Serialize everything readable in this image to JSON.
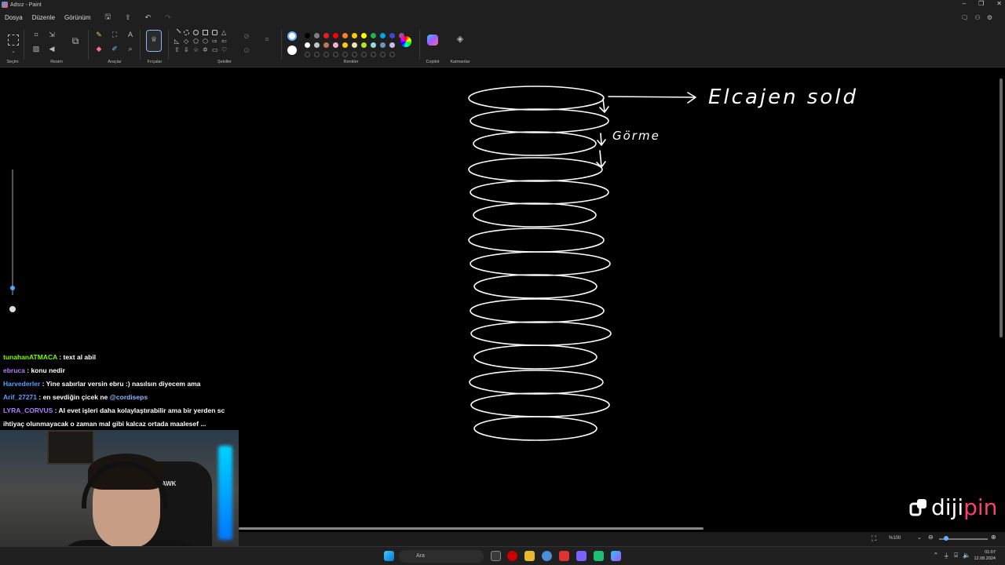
{
  "window": {
    "title": "Adsız - Paint"
  },
  "menu": {
    "items": [
      "Dosya",
      "Düzenle",
      "Görünüm"
    ]
  },
  "ribbon": {
    "groups": [
      "Seçim",
      "Resim",
      "Araçlar",
      "Fırçalar",
      "Şekiller",
      "Renkler",
      "Copilot",
      "Katmanlar"
    ],
    "colors_row1": [
      "#000000",
      "#7f7f7f",
      "#ed1c24",
      "#ff0000",
      "#ff7f27",
      "#ffc90e",
      "#ffff00",
      "#22b14c",
      "#00a2e8",
      "#3f48cc",
      "#a349a4"
    ],
    "colors_row2": [
      "#ffffff",
      "#c3c3c3",
      "#b97a57",
      "#ffaec9",
      "#ffc90e",
      "#efe4b0",
      "#b5e61d",
      "#99d9ea",
      "#7092be",
      "#c8bfe7"
    ]
  },
  "canvas": {
    "annotation_main": "Elcajen sold",
    "annotation_sub": "Görme"
  },
  "chat": {
    "messages": [
      {
        "user": "tunahanATMACA",
        "user_color": "#7cfc00",
        "text": ": text al abil"
      },
      {
        "user": "ebruca",
        "user_color": "#b57cff",
        "text": ": konu nedir"
      },
      {
        "user": "Harvederler",
        "user_color": "#5aa0ff",
        "text": ": Yine sabırlar versin ebru :) nasılsın diyecem ama"
      },
      {
        "user": "Arif_27271",
        "user_color": "#5aa0ff",
        "text": ": en sevdiğin çicek ne",
        "mention": "@cordiseps"
      },
      {
        "user": "LYRA_CORVUS",
        "user_color": "#b57cff",
        "text": ": AI evet işleri daha kolaylaştırabilir ama bir yerden sc"
      },
      {
        "user": "",
        "user_color": "#ffffff",
        "text": "ihtiyaç olunmayacak o zaman mal gibi kalcaz ortada maalesef ..."
      }
    ]
  },
  "webcam": {
    "chair_brand": "HAWK"
  },
  "status": {
    "zoom": "%100",
    "zoom_fraction": 0.1
  },
  "taskbar": {
    "search_placeholder": "Ara",
    "time": "01:07",
    "date": "12.08.2024"
  },
  "brand": {
    "name_main": "diji",
    "name_accent": "pin"
  }
}
